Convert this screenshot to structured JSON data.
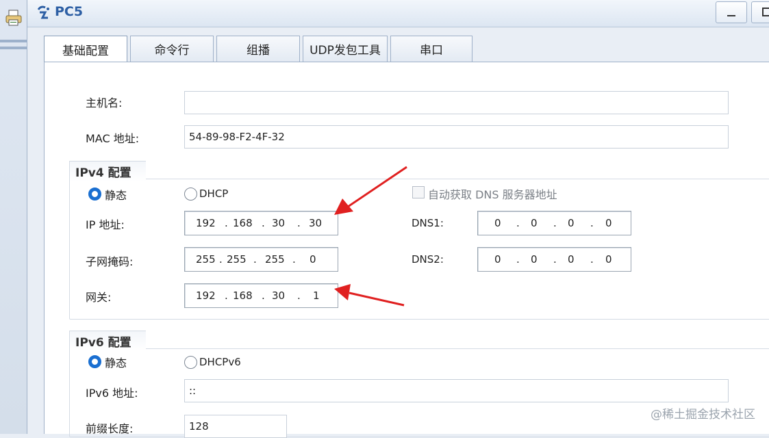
{
  "window": {
    "title": "PC5"
  },
  "tabs": [
    {
      "label": "基础配置",
      "active": true
    },
    {
      "label": "命令行"
    },
    {
      "label": "组播"
    },
    {
      "label": "UDP发包工具"
    },
    {
      "label": "串口"
    }
  ],
  "host": {
    "label": "主机名:",
    "value": ""
  },
  "mac": {
    "label": "MAC 地址:",
    "value": "54-89-98-F2-4F-32"
  },
  "ipv4": {
    "group_title": "IPv4 配置",
    "static_label": "静态",
    "dhcp_label": "DHCP",
    "auto_dns_label": "自动获取 DNS 服务器地址",
    "ip_label": "IP 地址:",
    "ip": [
      "192",
      "168",
      "30",
      "30"
    ],
    "mask_label": "子网掩码:",
    "mask": [
      "255",
      "255",
      "255",
      "0"
    ],
    "gateway_label": "网关:",
    "gateway": [
      "192",
      "168",
      "30",
      "1"
    ],
    "dns1_label": "DNS1:",
    "dns1": [
      "0",
      "0",
      "0",
      "0"
    ],
    "dns2_label": "DNS2:",
    "dns2": [
      "0",
      "0",
      "0",
      "0"
    ]
  },
  "ipv6": {
    "group_title": "IPv6 配置",
    "static_label": "静态",
    "dhcp_label": "DHCPv6",
    "addr_label": "IPv6 地址:",
    "addr": "::",
    "prefix_label": "前缀长度:",
    "prefix": "128"
  },
  "watermark": "@稀土掘金技术社区",
  "colors": {
    "accent": "#1a6fd1",
    "annotation_arrow": "#e02020"
  }
}
